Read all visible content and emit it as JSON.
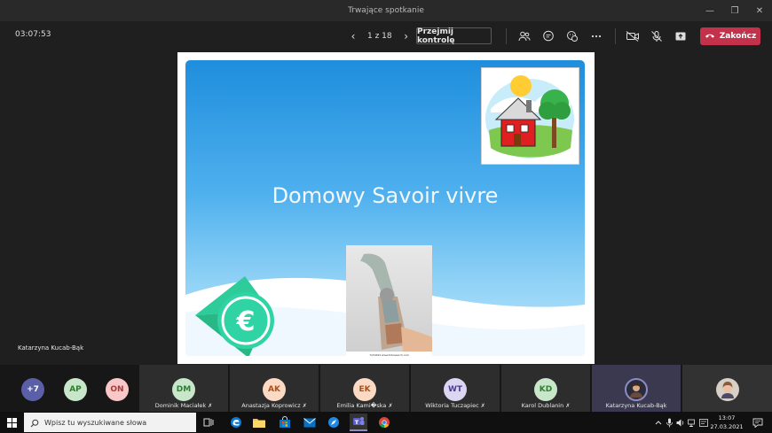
{
  "window": {
    "title": "Trwające spotkanie",
    "controls": [
      "minimize",
      "restore",
      "close"
    ]
  },
  "toolbar": {
    "timer": "03:07:53",
    "page_indicator": "1 z 18",
    "take_control_label": "Przejmij kontrolę",
    "end_call_label": "Zakończ",
    "icons": [
      "people-icon",
      "chat-icon",
      "reactions-icon",
      "more-icon",
      "camera-off-icon",
      "mic-off-icon",
      "share-icon"
    ]
  },
  "stage": {
    "presenter_name": "Katarzyna Kucab-Bąk",
    "slide": {
      "title": "Domowy Savoir vivre",
      "image_caption": "fo31694 www.fotosearch.com"
    }
  },
  "participants": {
    "overflow_count": "+7",
    "mini": [
      {
        "initials": "AP",
        "bg": "#c8e6c9",
        "fg": "#2e7d32"
      },
      {
        "initials": "ON",
        "bg": "#f8c8c8",
        "fg": "#a83a3a"
      }
    ],
    "tiles": [
      {
        "initials": "DM",
        "name": "Dominik Maciałek",
        "bg": "#c8e6c9",
        "fg": "#2e7d32"
      },
      {
        "initials": "AK",
        "name": "Anastazja Koprowicz",
        "bg": "#fbd9c3",
        "fg": "#a5521c"
      },
      {
        "initials": "EK",
        "name": "Emilia Kami�ska",
        "bg": "#fbd9c3",
        "fg": "#a5521c"
      },
      {
        "initials": "WT",
        "name": "Wiktoria Tuczapiec",
        "bg": "#dcd6f2",
        "fg": "#4c3f91"
      },
      {
        "initials": "KD",
        "name": "Karol Dublanin",
        "bg": "#c8e6c9",
        "fg": "#2e7d32"
      },
      {
        "initials": "",
        "name": "Katarzyna Kucab-Bąk",
        "bg": "#4a4a6a",
        "fg": "#fff"
      }
    ]
  },
  "taskbar": {
    "search_placeholder": "Wpisz tu wyszukiwane słowa",
    "time": "13:07",
    "date": "27.03.2021",
    "apps": [
      "task-view-icon",
      "edge-icon",
      "file-explorer-icon",
      "store-icon",
      "mail-icon",
      "browser-icon",
      "teams-icon",
      "chrome-icon"
    ]
  },
  "colors": {
    "end_call": "#c4314b",
    "teams_purple": "#6264a7"
  }
}
